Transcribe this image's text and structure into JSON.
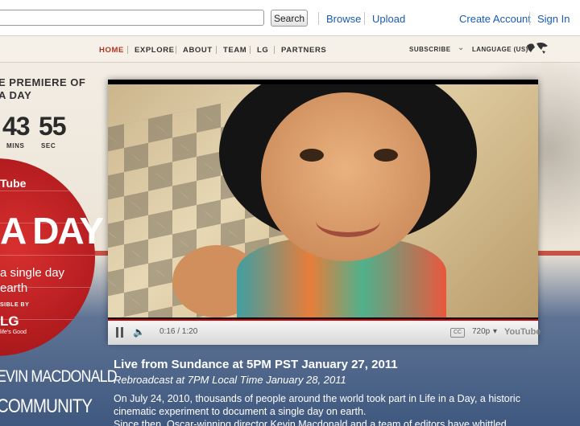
{
  "header": {
    "search_placeholder": "",
    "search_button": "Search",
    "links": [
      "Browse",
      "Upload"
    ],
    "account_links": [
      "Create Account",
      "Sign In"
    ]
  },
  "nav": {
    "items": [
      "HOME",
      "EXPLORE",
      "ABOUT",
      "TEAM",
      "LG",
      "PARTNERS"
    ],
    "subscribe": "SUBSCRIBE",
    "language": "LANGUAGE (US)"
  },
  "countdown": {
    "heading_line1": "E PREMIERE OF",
    "heading_line2": "A DAY",
    "mins_value": "43",
    "secs_value": "55",
    "mins_label": "MINS",
    "secs_label": "SEC"
  },
  "promo": {
    "brand": "Tube",
    "title": "A DAY",
    "tagline_line1": "a single day",
    "tagline_line2": "earth",
    "sponsored": "SIBLE BY",
    "sponsor": "LG",
    "sponsor_slogan": "life's Good",
    "director": "EVIN MACDONALD",
    "community": "COMMUNITY"
  },
  "player": {
    "time": "0:16 / 1:20",
    "quality": "720p",
    "cc": "CC",
    "logo": "YouTube",
    "progress": 0.2
  },
  "event": {
    "title": "Live from Sundance at 5PM PST January 27, 2011",
    "rebroadcast": "Rebroadcast at 7PM Local Time January 28, 2011",
    "desc_line1": "On July 24, 2010, thousands of people around the world took part in Life in a Day, a historic",
    "desc_line2": "cinematic experiment to document a single day on earth.",
    "desc_line3": "Since then, Oscar-winning director Kevin Macdonald and a team of editors have whittled"
  },
  "colors": {
    "link": "#1a5ab5",
    "accent_red": "#b3321f",
    "nav_active": "#b3321f"
  }
}
